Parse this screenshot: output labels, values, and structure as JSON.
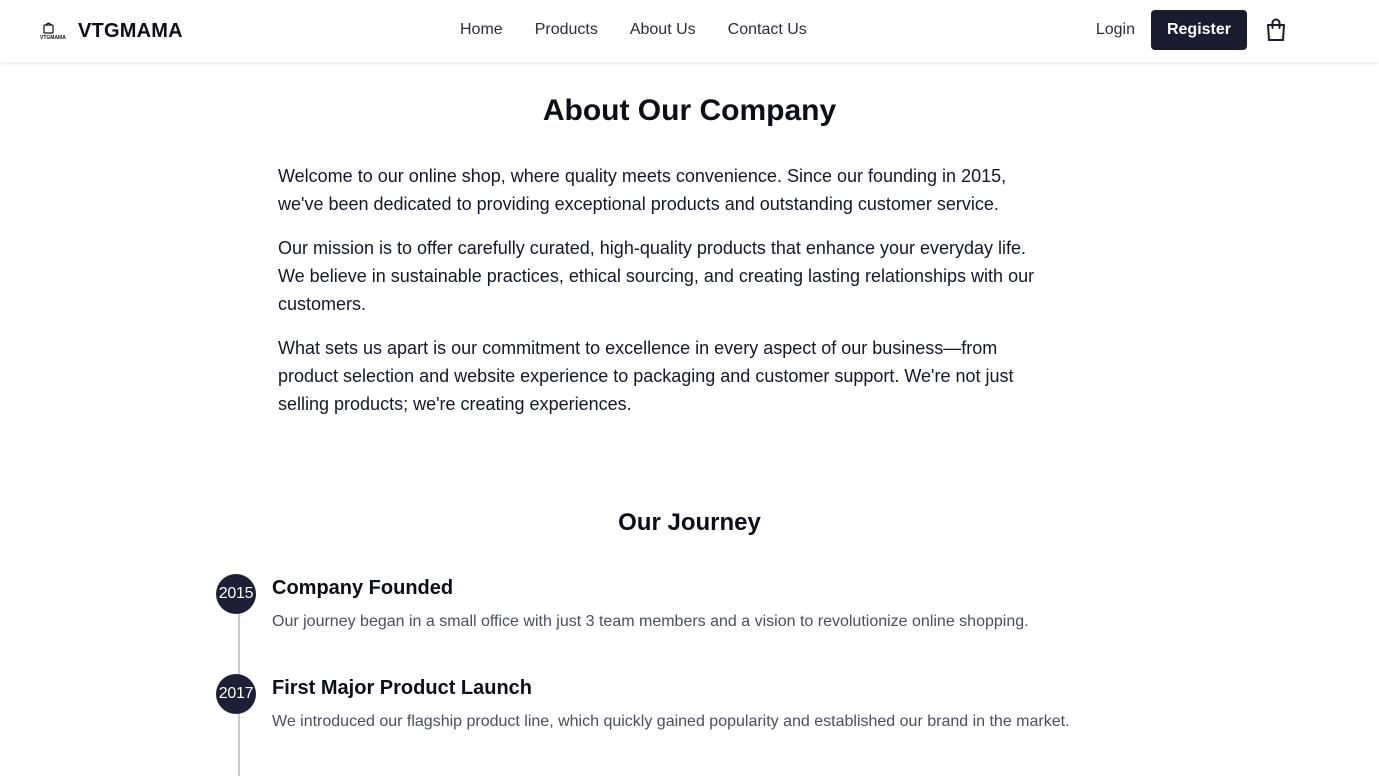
{
  "header": {
    "brand_name": "VTGMAMA",
    "logo_text": "VTGMAMA",
    "nav": [
      "Home",
      "Products",
      "About Us",
      "Contact Us"
    ],
    "login_label": "Login",
    "register_label": "Register",
    "cart_icon": "shopping-bag-icon"
  },
  "about": {
    "title": "About Our Company",
    "paragraphs": [
      "Welcome to our online shop, where quality meets convenience. Since our founding in 2015, we've been dedicated to providing exceptional products and outstanding customer service.",
      "Our mission is to offer carefully curated, high-quality products that enhance your everyday life. We believe in sustainable practices, ethical sourcing, and creating lasting relationships with our customers.",
      "What sets us apart is our commitment to excellence in every aspect of our business—from product selection and website experience to packaging and customer support. We're not just selling products; we're creating experiences."
    ]
  },
  "journey": {
    "title": "Our Journey",
    "milestones": [
      {
        "year": "2015",
        "title": "Company Founded",
        "description": "Our journey began in a small office with just 3 team members and a vision to revolutionize online shopping."
      },
      {
        "year": "2017",
        "title": "First Major Product Launch",
        "description": "We introduced our flagship product line, which quickly gained popularity and established our brand in the market."
      }
    ]
  },
  "colors": {
    "primary_dark": "#191b2e",
    "timeline_dot": "#1c1f35",
    "timeline_line": "#c9cbd6",
    "muted_text": "#4a4e5e"
  }
}
